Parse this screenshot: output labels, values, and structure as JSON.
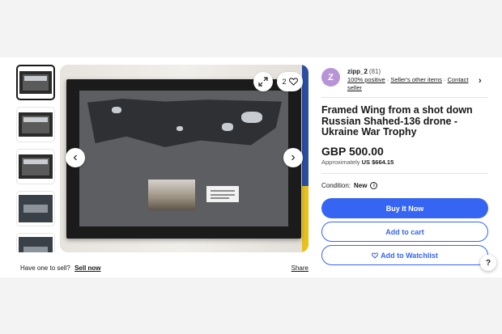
{
  "gallery": {
    "thumbnails": [
      "thumb-1",
      "thumb-2",
      "thumb-3",
      "thumb-4",
      "thumb-5"
    ],
    "watch_count": "2",
    "prev_icon": "chevron-left-icon",
    "next_icon": "chevron-right-icon",
    "expand_icon": "expand-icon",
    "heart_icon": "heart-icon"
  },
  "below_gallery": {
    "sell_prompt": "Have one to sell?",
    "sell_link": "Sell now",
    "share": "Share"
  },
  "seller": {
    "avatar_letter": "Z",
    "name": "zipp_2",
    "count": "(81)",
    "positive": "100% positive",
    "sep1": " · ",
    "other_items": "Seller's other items",
    "sep2": " · ",
    "contact": "Contact seller"
  },
  "listing": {
    "title": "Framed Wing from a shot down Russian Shahed-136 drone - Ukraine War Trophy",
    "price": "GBP 500.00",
    "approx_label": "Approximately",
    "approx_value": "US $664.15",
    "condition_label": "Condition:",
    "condition_value": "New"
  },
  "actions": {
    "buy_now": "Buy It Now",
    "add_to_cart": "Add to cart",
    "add_to_watchlist": "Add to Watchlist",
    "help": "?"
  },
  "colors": {
    "accent": "#3665f3",
    "avatar": "#b794d6"
  }
}
